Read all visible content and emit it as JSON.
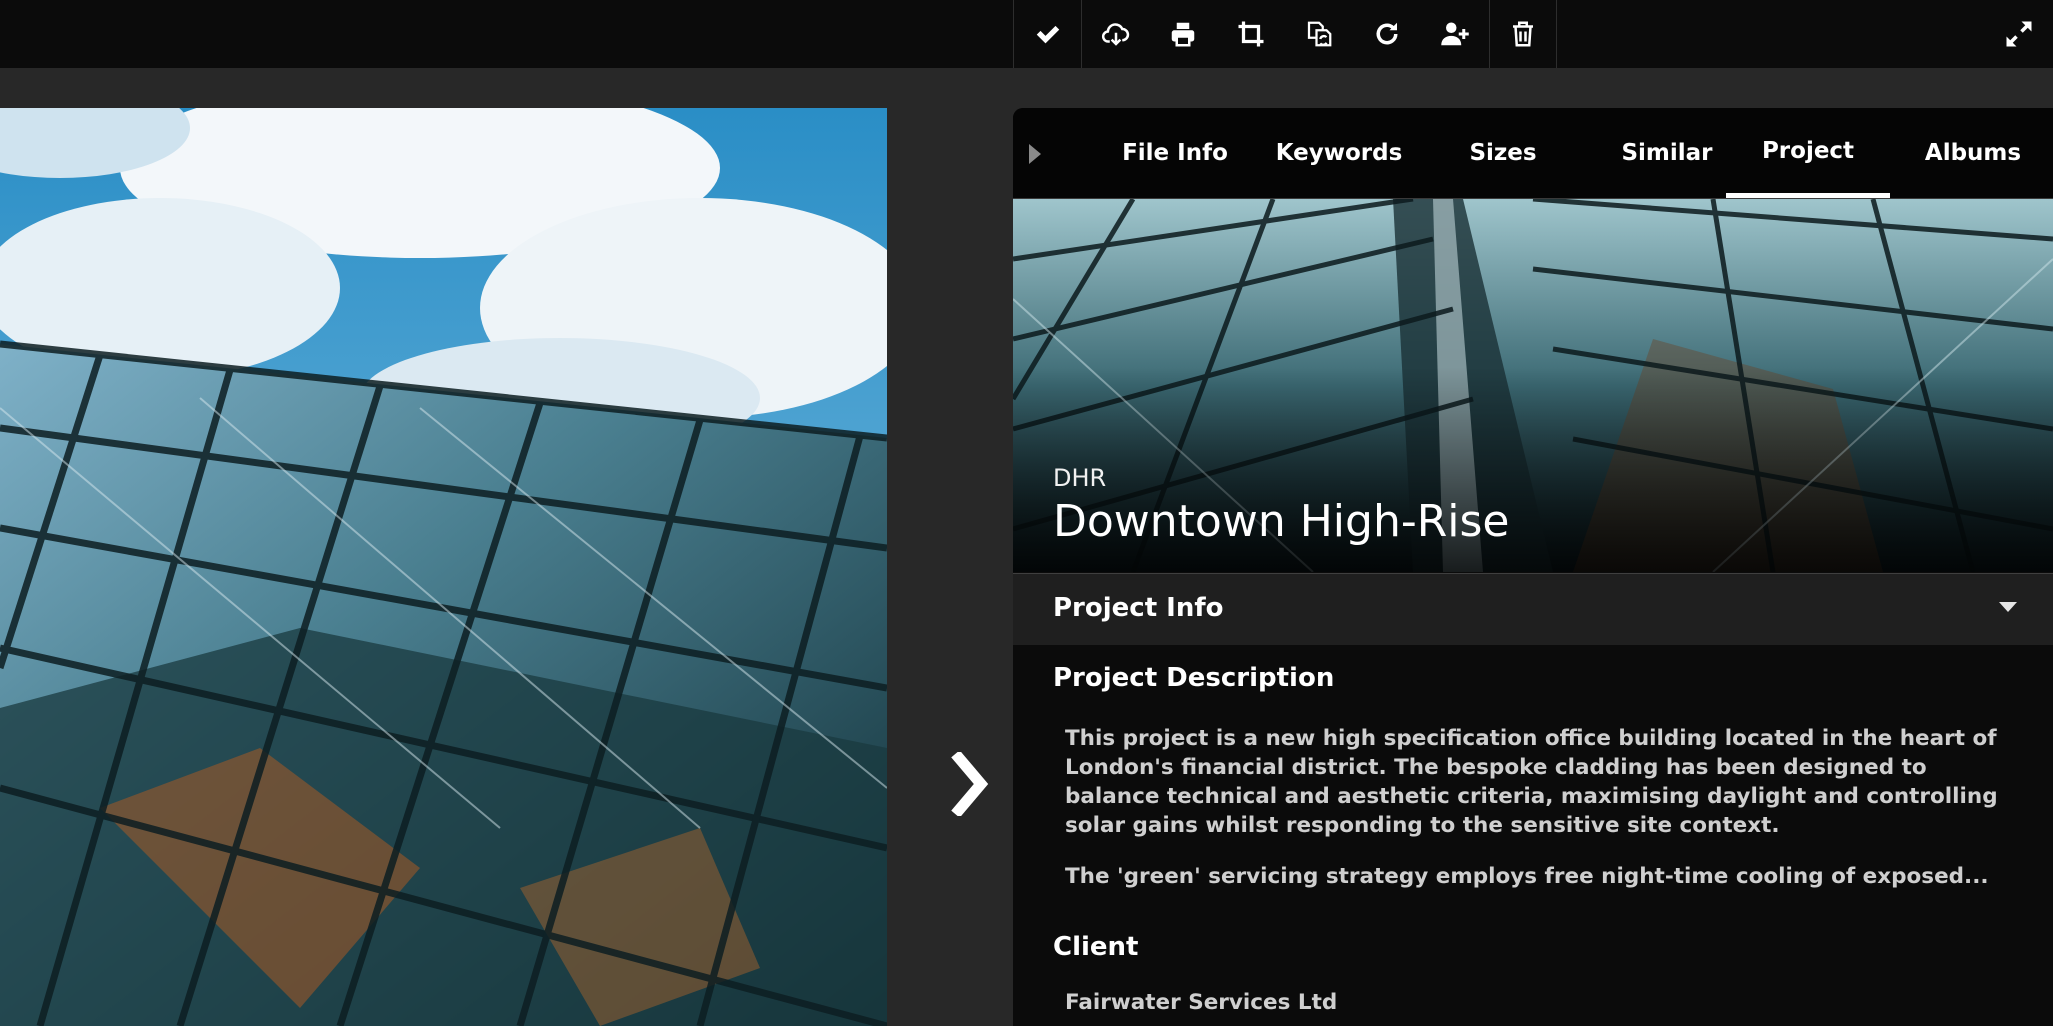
{
  "toolbar": {
    "tools": [
      {
        "name": "approve",
        "icon": "check-icon"
      },
      {
        "name": "download",
        "icon": "cloud-download-icon"
      },
      {
        "name": "print",
        "icon": "printer-icon"
      },
      {
        "name": "crop",
        "icon": "crop-icon"
      },
      {
        "name": "replace",
        "icon": "swap-files-icon"
      },
      {
        "name": "rotate",
        "icon": "rotate-icon"
      },
      {
        "name": "add-user",
        "icon": "add-user-icon"
      },
      {
        "name": "delete",
        "icon": "trash-icon"
      }
    ],
    "expand_icon": "expand-icon"
  },
  "tabs": [
    "File Info",
    "Keywords",
    "Sizes",
    "Similar",
    "Project",
    "Albums"
  ],
  "active_tab": "Project",
  "project": {
    "code": "DHR",
    "title": "Downtown High-Rise"
  },
  "section": {
    "title": "Project Info"
  },
  "fields": {
    "description_label": "Project Description",
    "description_p1": "This project is a new high specification office building located in the heart of London's financial district. The bespoke cladding has been designed to balance technical and aesthetic criteria, maximising daylight and controlling solar gains whilst responding to the sensitive site context.",
    "description_p2": "The 'green' servicing strategy employs free night-time cooling of exposed...",
    "client_label": "Client",
    "client_value": "Fairwater Services Ltd"
  },
  "colors": {
    "toolbar_bg": "#0b0b0b",
    "page_bg": "#282828",
    "panel_bg": "#0b0b0b",
    "section_bg": "#1f1f1f"
  }
}
